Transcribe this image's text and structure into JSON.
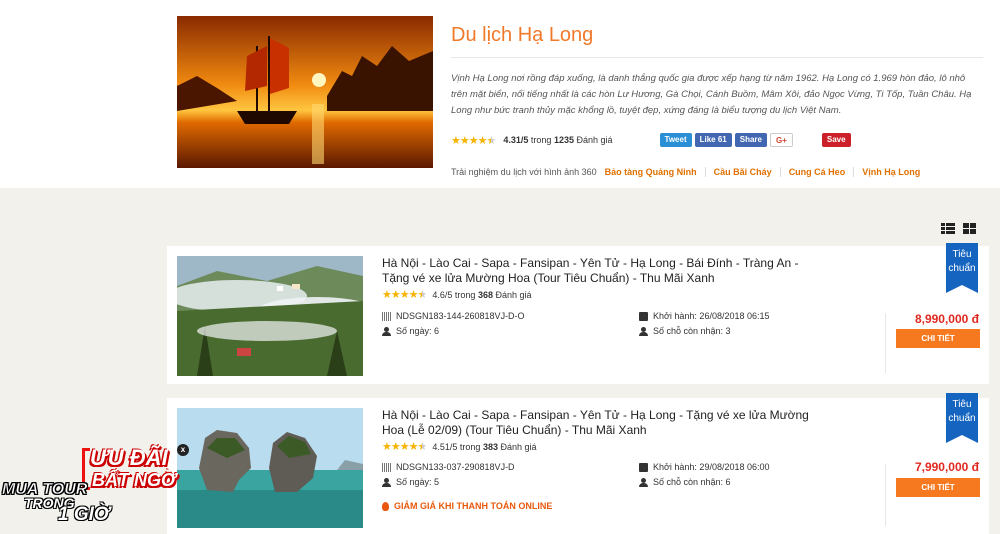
{
  "hero": {
    "title": "Du lịch Hạ Long",
    "description": "Vịnh Hạ Long nơi rồng đáp xuống, là danh thắng quốc gia được xếp hạng từ năm 1962. Hạ Long có 1.969 hòn đảo, lô nhô trên mặt biển, nổi tiếng nhất là các hòn Lư Hương, Gà Chọi, Cánh Buồm, Mâm Xôi, đảo Ngọc Vừng, Ti Tốp, Tuần Châu. Hạ Long như bức tranh thủy mặc khổng lồ, tuyệt đẹp, xứng đáng là biểu tượng du lịch Việt Nam.",
    "rating": {
      "score": "4.31/5",
      "in": "trong",
      "count": "1235",
      "suffix": "Đánh giá",
      "stars_value": 4.31
    },
    "social": {
      "tweet": "Tweet",
      "like": "Like 61",
      "share": "Share",
      "gplus": "G+",
      "save": "Save"
    },
    "experience": {
      "label": "Trải nghiệm du lịch với hình ảnh 360",
      "links": [
        "Bảo tàng Quảng Ninh",
        "Cầu Bãi Cháy",
        "Cung Cá Heo",
        "Vịnh Hạ Long"
      ]
    }
  },
  "tours": [
    {
      "title": "Hà Nội - Lào Cai - Sapa - Fansipan - Yên Tử - Hạ Long - Bái Đính - Tràng An - Tặng vé xe lửa Mường Hoa (Tour Tiêu Chuẩn) - Thu Mãi Xanh",
      "rating": {
        "score": "4.6/5",
        "in": "trong",
        "count": "368",
        "suffix": "Đánh giá",
        "stars_value": 4.6
      },
      "code": "NDSGN183-144-260818VJ-D-O",
      "days": "Số ngày: 6",
      "departure": "Khởi hành: 26/08/2018 06:15",
      "seats": "Số chỗ còn nhận: 3",
      "price": "8,990,000 đ",
      "button": "CHI TIẾT",
      "ribbon": [
        "Tiêu",
        "chuẩn"
      ]
    },
    {
      "title": "Hà Nội - Lào Cai - Sapa - Fansipan - Yên Tử - Hạ Long - Tặng vé xe lửa Mường Hoa (Lễ 02/09) (Tour Tiêu Chuẩn) - Thu Mãi Xanh",
      "rating": {
        "score": "4.51/5",
        "in": "trong",
        "count": "383",
        "suffix": "Đánh giá",
        "stars_value": 4.51
      },
      "code": "NDSGN133-037-290818VJ-D",
      "days": "Số ngày: 5",
      "departure": "Khởi hành: 29/08/2018 06:00",
      "seats": "Số chỗ còn nhận: 6",
      "price": "7,990,000 đ",
      "button": "CHI TIẾT",
      "ribbon": [
        "Tiêu",
        "chuẩn"
      ],
      "promo": "GIẢM GIÁ KHI THANH TOÁN ONLINE"
    }
  ],
  "float_badge": {
    "line1": "MUA TOUR",
    "line2": "TRONG",
    "line3": "1 GIỜ",
    "line4": "ƯU ĐÃI",
    "line5": "BẤT NGỜ",
    "close": "x"
  },
  "colors": {
    "accent": "#f0792a",
    "price": "#e0281f",
    "button": "#f6791f",
    "ribbon": "#1565c0",
    "star": "#f5b400"
  }
}
